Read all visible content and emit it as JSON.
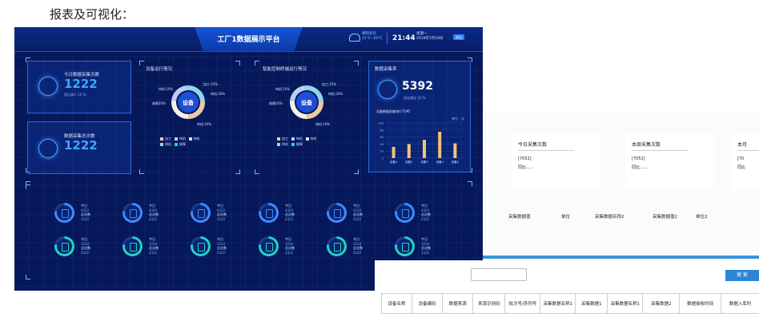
{
  "doc_heading": "报表及可视化：",
  "dashboard": {
    "title": "工厂1数据展示平台",
    "weather": [
      "晴转多云",
      "12℃~20℃"
    ],
    "time": "21:44",
    "date": [
      "星期一",
      "2019年7月18日"
    ],
    "top_button": "退出",
    "today_panel": {
      "title": "今日数据采集次数",
      "value": "1222",
      "sub": "同比减少 10 %"
    },
    "total_panel": {
      "title": "数据采集总次数",
      "value": "1222"
    },
    "equip_panel": {
      "title": "设备运行情况",
      "center": "设备",
      "labels": [
        "加工:15%",
        "待机:10%",
        "待机:20%",
        "故障20%",
        "待机:10%"
      ],
      "legend": [
        "加工",
        "待机",
        "待机",
        "待机",
        "故障"
      ]
    },
    "terminal_panel": {
      "title": "智能控制终端运行情况",
      "center": "设备",
      "labels": [
        "加工:15%",
        "待机:10%",
        "待机:20%",
        "故障20%",
        "待机:10%"
      ],
      "legend": [
        "加工",
        "待机",
        "待机",
        "待机",
        "故障"
      ]
    },
    "rate_panel": {
      "title": "数据采集率",
      "value": "5392",
      "sub": "同比增长 10 %",
      "chart_title": "设备数据采集排行TOP5",
      "unit": "单位：次"
    },
    "gauges_row1": {
      "k1": "今日",
      "v1": "4322",
      "k2": "总次数",
      "v2": "4322"
    },
    "gauges_row2": {
      "k1": "今日",
      "v1": "1234",
      "k2": "总次数",
      "v2": "4322"
    },
    "colors": {
      "bg": "#06185a",
      "accent": "#3fa6ff",
      "teal": "#22d3c5"
    }
  },
  "chart_data": {
    "type": "bar",
    "title": "设备数据采集排行TOP5",
    "categories": [
      "设备1",
      "设备2",
      "设备3",
      "设备4",
      "设备5"
    ],
    "values": [
      32,
      40,
      52,
      75,
      42
    ],
    "ylim": [
      0,
      100
    ],
    "yticks": [
      "100",
      "80",
      "60",
      "40",
      "20",
      "0"
    ]
  },
  "web_ui": {
    "card1": {
      "title": "今日采集次数",
      "a": "[7052]",
      "b": "同比......"
    },
    "card2": {
      "title": "本周采集次数",
      "a": "[7052]",
      "b": "同比......"
    },
    "card3": {
      "title": "本月",
      "a": "[70",
      "b": "同比"
    },
    "cols": [
      "采集数据值",
      "单位",
      "采集数据名称2",
      "采集数据值2",
      "单位2"
    ],
    "search_button": "搜 索",
    "table_headers": [
      "设备名称",
      "设备编码",
      "数据来源",
      "来源识别码",
      "批次号/序列号",
      "采集数据名称1",
      "采集数据1",
      "采集数据名称1",
      "采集数据2",
      "数据接收时间",
      "数据入库时"
    ]
  }
}
